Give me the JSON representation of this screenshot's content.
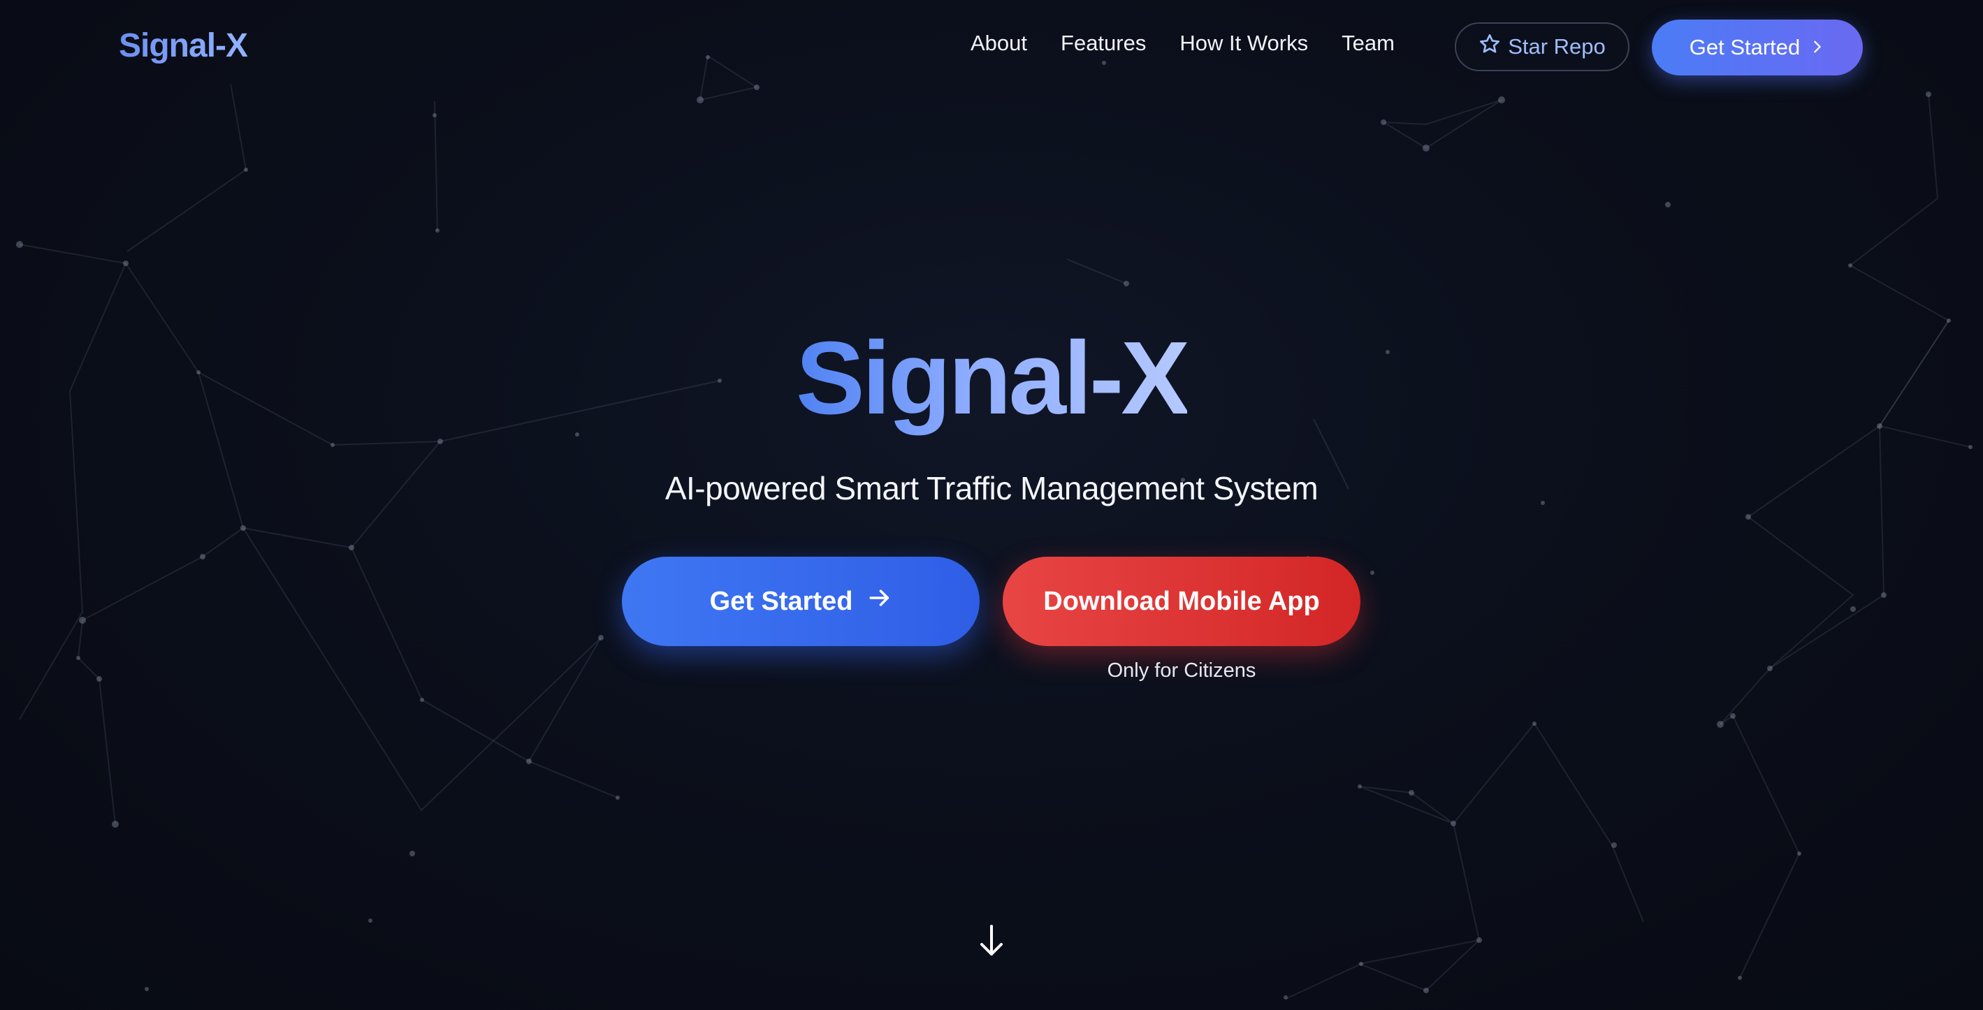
{
  "brand": {
    "name": "Signal-X"
  },
  "nav": {
    "links": [
      "About",
      "Features",
      "How It Works",
      "Team"
    ],
    "star_repo_label": "Star Repo",
    "cta_label": "Get Started"
  },
  "hero": {
    "title": "Signal-X",
    "subtitle": "AI-powered Smart Traffic Management System",
    "primary_button_label": "Get Started",
    "secondary_button_label": "Download Mobile App",
    "secondary_caption": "Only for Citizens"
  },
  "icons": {
    "star": "star-icon",
    "chevron": "chevron-right-icon",
    "arrow": "arrow-right-icon",
    "scroll": "arrow-down-icon"
  },
  "colors": {
    "background": "#0a0d17",
    "accent_blue": "#3f77f3",
    "accent_purple": "#6a69f2",
    "accent_red": "#e84545",
    "link_blue": "#9fbdfd"
  }
}
